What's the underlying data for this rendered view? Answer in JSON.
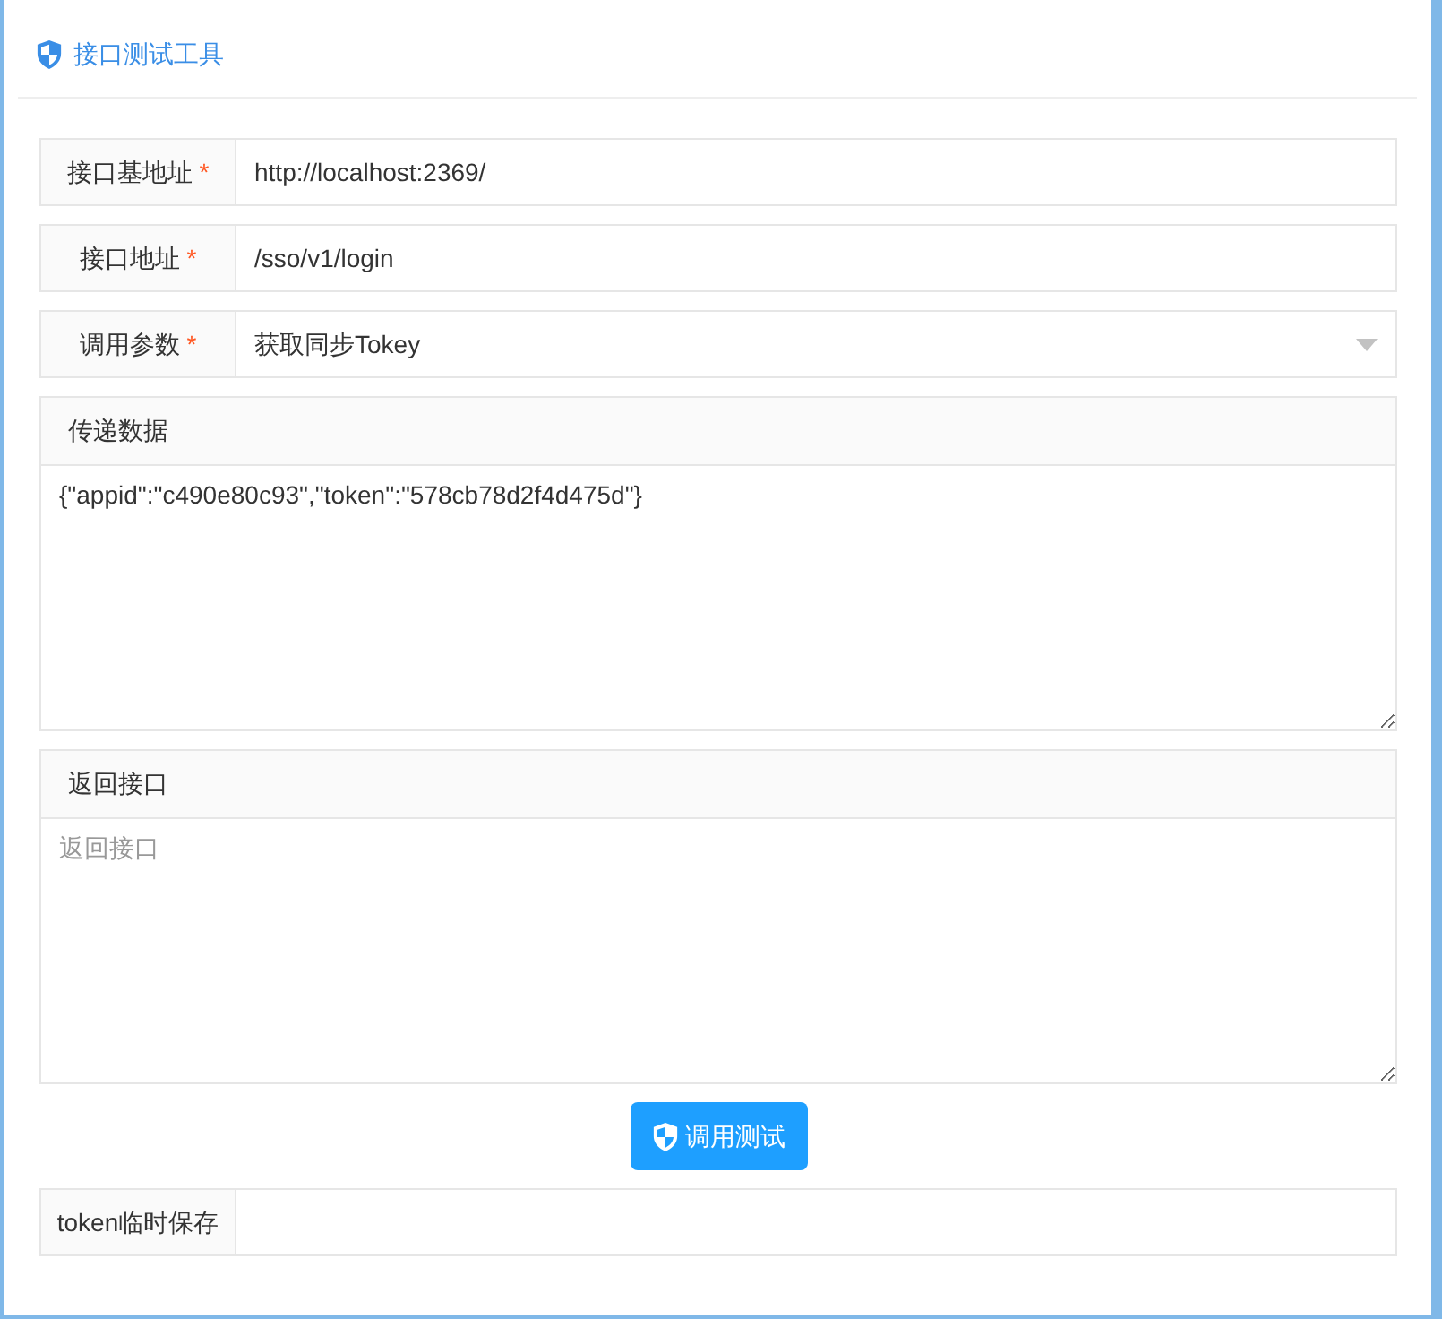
{
  "header": {
    "title": "接口测试工具"
  },
  "fields": [
    {
      "kind": "input",
      "label": "接口基地址",
      "required_mark": "*",
      "value": "http://localhost:2369/"
    },
    {
      "kind": "input",
      "label": "接口地址",
      "required_mark": "*",
      "value": "/sso/v1/login"
    },
    {
      "kind": "select",
      "label": "调用参数",
      "required_mark": "*",
      "value": "获取同步Tokey"
    }
  ],
  "text_areas": [
    {
      "label": "传递数据",
      "value": "{\"appid\":\"c490e80c93\",\"token\":\"578cb78d2f4d475d\"}"
    },
    {
      "label": "返回接口",
      "placeholder": "返回接口"
    }
  ],
  "submit_button": {
    "label": "调用测试"
  },
  "token_field": {
    "label": "token临时保存"
  }
}
